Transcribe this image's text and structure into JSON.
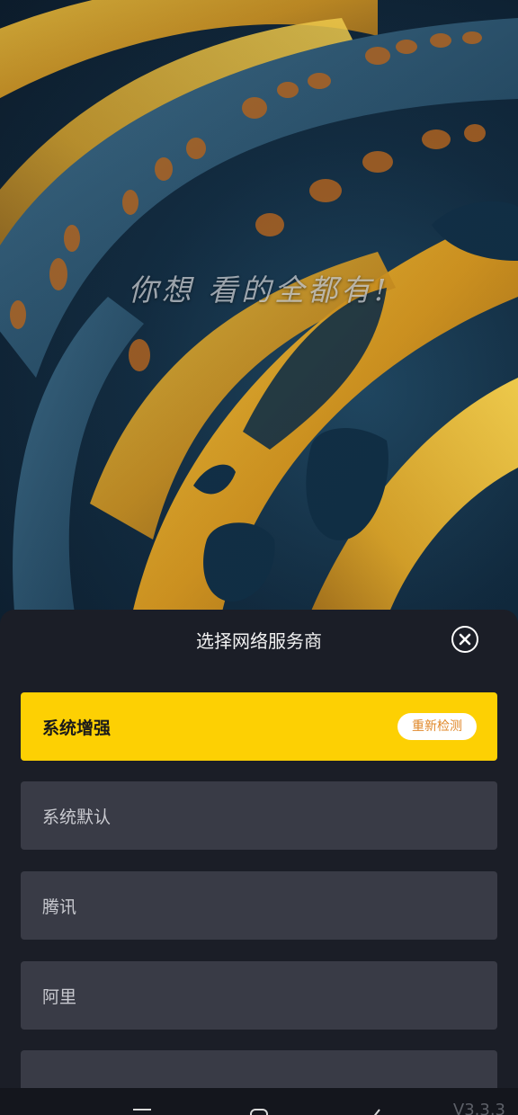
{
  "splash": {
    "slogan": "你想 看的全都有!"
  },
  "sheet": {
    "title": "选择网络服务商",
    "close_icon": "close-circle-icon",
    "providers": [
      {
        "label": "系统增强",
        "selected": true,
        "action_label": "重新检测"
      },
      {
        "label": "系统默认",
        "selected": false
      },
      {
        "label": "腾讯",
        "selected": false
      },
      {
        "label": "阿里",
        "selected": false
      },
      {
        "label": "",
        "selected": false
      }
    ]
  },
  "navbar": {
    "icons": [
      "menu-icon",
      "home-icon",
      "back-icon"
    ],
    "version": "V3.3.3"
  },
  "colors": {
    "accent": "#fdd003",
    "sheet_background": "#1b1e27",
    "item_background": "#393b46",
    "recheck_text": "#e0882a"
  }
}
